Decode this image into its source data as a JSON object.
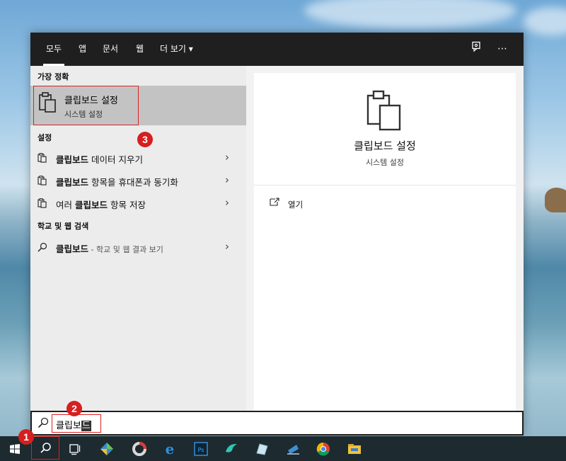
{
  "tabs": [
    {
      "label": "모두"
    },
    {
      "label": "앱"
    },
    {
      "label": "문서"
    },
    {
      "label": "웹"
    },
    {
      "label": "더 보기 ▾"
    }
  ],
  "topbar_icons": {
    "feedback": "feedback-icon",
    "more": "⋯"
  },
  "left": {
    "best_match_heading": "가장 정확",
    "best_match": {
      "title": "클립보드 설정",
      "subtitle": "시스템 설정",
      "icon": "clipboard-icon"
    },
    "settings_heading": "설정",
    "settings_items": [
      {
        "bold": "클립보드",
        "rest": " 데이터 지우기"
      },
      {
        "bold": "클립보드",
        "rest": " 항목을 휴대폰과 동기화"
      },
      {
        "pre": "여러 ",
        "bold": "클립보드",
        "rest": " 항목 저장"
      }
    ],
    "web_heading": "학교 및 웹 검색",
    "web_item": {
      "bold": "클립보드",
      "rest": " - 학교 및 웹 결과 보기"
    }
  },
  "right": {
    "title": "클립보드 설정",
    "subtitle": "시스템 설정",
    "open_label": "열기"
  },
  "search": {
    "typed": "클립보",
    "selected": "드"
  },
  "badges": [
    "1",
    "2",
    "3"
  ],
  "taskbar_icons": [
    "windows-start-icon",
    "search-icon",
    "task-view-icon",
    "app-icon",
    "app-icon",
    "edge-icon",
    "photoshop-icon",
    "app-icon",
    "app-icon",
    "app-icon",
    "chrome-icon",
    "file-explorer-icon"
  ],
  "colors": {
    "highlight": "#e02020",
    "topbar": "#1f1f1f",
    "selected_row": "#c3c3c3"
  }
}
